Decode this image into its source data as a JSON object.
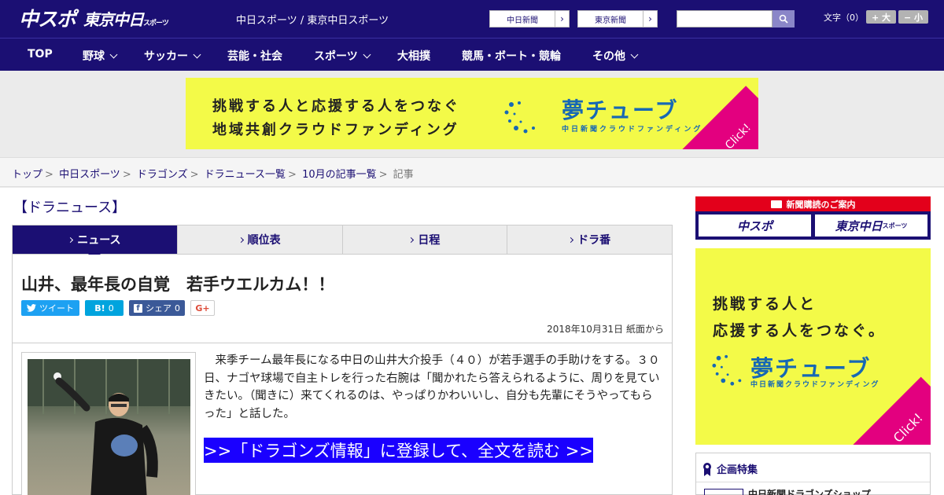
{
  "header": {
    "logo_chuspo": "中スポ",
    "logo_tokyo": "東京中日",
    "logo_tokyo_small": "スポーツ",
    "site_name": "中日スポーツ / 東京中日スポーツ",
    "ext_links": [
      "中日新聞",
      "東京新聞"
    ],
    "font_size_label": "文字（0）",
    "font_plus": "+ 大",
    "font_minus": "− 小"
  },
  "nav": {
    "items": [
      {
        "label": "TOP",
        "dropdown": false
      },
      {
        "label": "野球",
        "dropdown": true
      },
      {
        "label": "サッカー",
        "dropdown": true
      },
      {
        "label": "芸能・社会",
        "dropdown": false
      },
      {
        "label": "スポーツ",
        "dropdown": true
      },
      {
        "label": "大相撲",
        "dropdown": false
      },
      {
        "label": "競馬・ボート・競輪",
        "dropdown": false
      },
      {
        "label": "その他",
        "dropdown": true
      }
    ]
  },
  "ad_top": {
    "line1": "挑戦する人と応援する人をつなぐ",
    "line2": "地域共創クラウドファンディング",
    "brand": "夢チューブ",
    "sub": "中日新聞クラウドファンディング",
    "click": "Click!"
  },
  "breadcrumb": {
    "items": [
      "トップ",
      "中日スポーツ",
      "ドラゴンズ",
      "ドラニュース一覧",
      "10月の記事一覧"
    ],
    "current": "記事",
    "sep": ">"
  },
  "section_title": "【ドラニュース】",
  "tabs": [
    "ニュース",
    "順位表",
    "日程",
    "ドラ番"
  ],
  "article": {
    "headline": "山井、最年長の自覚　若手ウエルカム！！",
    "share": {
      "tweet": "ツイート",
      "hatena_label": "B!",
      "hatena_count": "0",
      "facebook": "シェア",
      "facebook_count": "0",
      "gplus": "G+"
    },
    "date": "2018年10月31日 紙面から",
    "body": "来季チーム最年長になる中日の山井大介投手（４０）が若手選手の手助けをする。３０日、ナゴヤ球場で自主トレを行った右腕は「聞かれたら答えられるように、周りを見ていきたい。（聞きに）来てくれるのは、やっぱりかわいいし、自分も先輩にそうやってもらった」と話した。",
    "cta": ">>「ドラゴンズ情報」に登録して、全文を読む >>"
  },
  "sidebar": {
    "subscription_head": "新聞購読のご案内",
    "sub_btn1": "中スポ",
    "sub_btn2": "東京中日",
    "sub_btn2_small": "スポーツ",
    "ad": {
      "line1": "挑戦する人と",
      "line2": "応援する人をつなぐ。",
      "brand": "夢チューブ",
      "sub": "中日新聞クラウドファンディング",
      "click": "Click!"
    },
    "feature_head": "企画特集",
    "feature_item": "中日新聞ドラゴンズショップ"
  },
  "colors": {
    "brand_navy": "#1b0f73",
    "ad_yellow": "#f3fa48",
    "ad_blue": "#1768b4",
    "ad_pink": "#e3007f",
    "cta_blue": "#1a00ff",
    "twitter": "#1da1f2",
    "hatena": "#00a4de",
    "facebook": "#3b5998",
    "gplus": "#dd4b39"
  }
}
